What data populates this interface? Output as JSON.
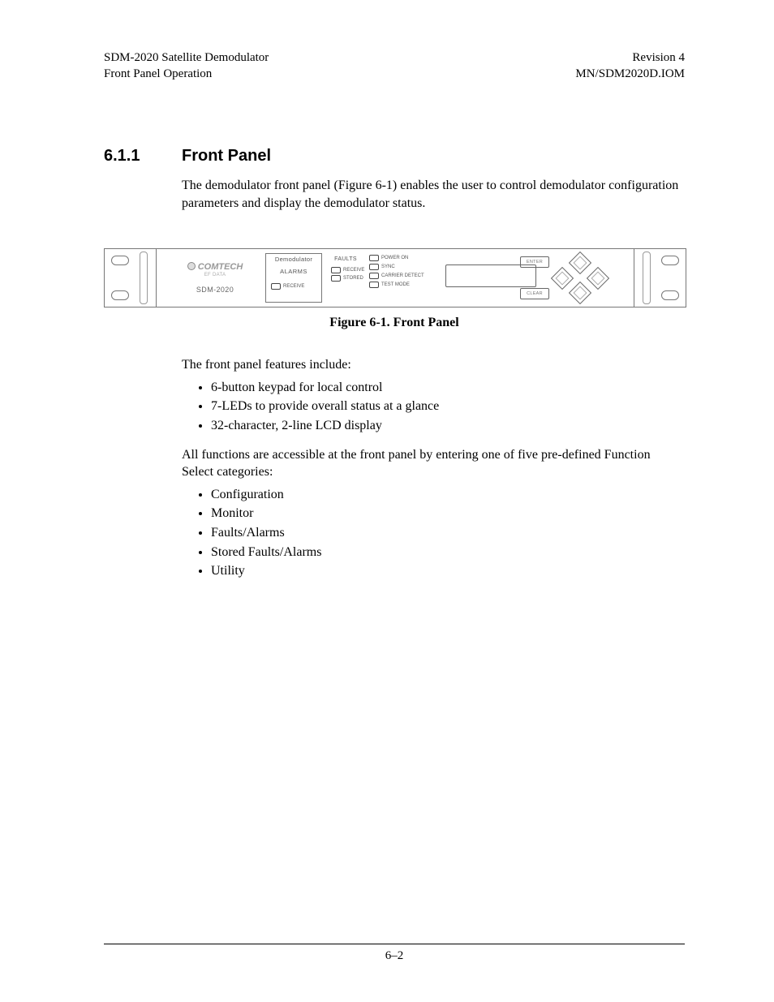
{
  "header": {
    "left1": "SDM-2020 Satellite Demodulator",
    "left2": "Front Panel Operation",
    "right1": "Revision 4",
    "right2": "MN/SDM2020D.IOM"
  },
  "section": {
    "number": "6.1.1",
    "title": "Front Panel"
  },
  "para1": "The demodulator front panel (Figure 6-1) enables the user to control demodulator configuration parameters and display the demodulator status.",
  "figure": {
    "caption": "Figure 6-1.  Front Panel",
    "logo_name": "COMTECH",
    "logo_sub": "EF DATA",
    "logo_model": "SDM-2020",
    "box1_line1": "Demodulator",
    "box1_line2": "ALARMS",
    "box1_led": "RECEIVE",
    "col2_head": "FAULTS",
    "col2_a": "RECEIVE",
    "col2_b": "STORED",
    "col3_a": "POWER ON",
    "col3_b": "SYNC",
    "col3_c": "CARRIER DETECT",
    "col3_d": "TEST MODE",
    "btn_enter": "ENTER",
    "btn_clear": "CLEAR"
  },
  "para2": "The front panel features include:",
  "features": [
    "6-button keypad for local control",
    "7-LEDs to provide overall status at a glance",
    "32-character, 2-line LCD display"
  ],
  "para3": "All functions are accessible at the front panel by entering one of five pre-defined Function Select categories:",
  "categories": [
    "Configuration",
    "Monitor",
    "Faults/Alarms",
    "Stored Faults/Alarms",
    "Utility"
  ],
  "footer": "6–2"
}
